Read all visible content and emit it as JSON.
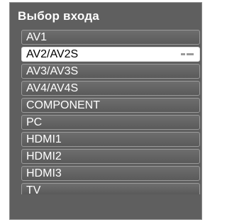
{
  "menu": {
    "title": "Выбор входа",
    "items": [
      {
        "label": "AV1"
      },
      {
        "label": "AV2/AV2S"
      },
      {
        "label": "AV3/AV3S"
      },
      {
        "label": "AV4/AV4S"
      },
      {
        "label": "COMPONENT"
      },
      {
        "label": "PC"
      },
      {
        "label": "HDMI1"
      },
      {
        "label": "HDMI2"
      },
      {
        "label": "HDMI3"
      },
      {
        "label": "TV"
      }
    ],
    "selected_label": "AV2/AV2S"
  },
  "colors": {
    "panel_bg": "#5f5f5f",
    "item_bg": "#666666",
    "selected_bg": "#ffffff",
    "text": "#ffffff"
  }
}
